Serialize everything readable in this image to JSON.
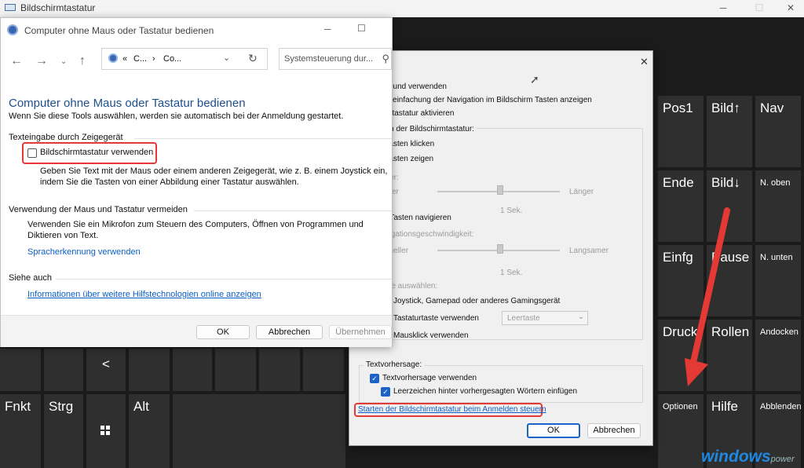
{
  "osk": {
    "title": "Bildschirmtastatur",
    "keys_right": [
      {
        "label": "Pos1"
      },
      {
        "label": "Bild↑"
      },
      {
        "label": "Nav"
      },
      {
        "label": "Ende"
      },
      {
        "label": "Bild↓"
      },
      {
        "label": "N. oben"
      },
      {
        "label": "Einfg"
      },
      {
        "label": "Pause"
      },
      {
        "label": "N. unten"
      },
      {
        "label": "Druck"
      },
      {
        "label": "Rollen"
      },
      {
        "label": "Andocken"
      },
      {
        "label": "Optionen"
      },
      {
        "label": "Hilfe"
      },
      {
        "label": "Abblenden"
      }
    ],
    "bottom_keys": {
      "fn": "Fnkt",
      "ctrl": "Strg",
      "alt": "Alt",
      "left_arrow": "<"
    },
    "watermark": "windowspower"
  },
  "win1": {
    "title": "Computer ohne Maus oder Tastatur bedienen",
    "address_parts": [
      "«",
      "C...",
      "›",
      "Co..."
    ],
    "search_placeholder": "Systemsteuerung dur...",
    "heading": "Computer ohne Maus oder Tastatur bedienen",
    "intro": "Wenn Sie diese Tools auswählen, werden sie automatisch bei der Anmeldung gestartet.",
    "section1": {
      "title": "Texteingabe durch Zeigegerät",
      "checkbox_label": "Bildschirmtastatur verwenden",
      "desc_line1": "Geben Sie Text mit der Maus oder einem anderen Zeigegerät, wie z. B. einem Joystick ein,",
      "desc_line2": "indem Sie die Tasten von einer Abbildung einer Tastatur auswählen."
    },
    "section2": {
      "title": "Verwendung der Maus und Tastatur vermeiden",
      "desc_line1": "Verwenden Sie ein Mikrofon zum Steuern des Computers, Öffnen von Programmen und",
      "desc_line2": "Diktieren von Text.",
      "link": "Spracherkennung verwenden"
    },
    "section3": {
      "title": "Siehe auch",
      "link": "Informationen über weitere Hilfstechnologien online anzeigen"
    },
    "buttons": {
      "ok": "OK",
      "cancel": "Abbrechen",
      "apply": "Übernehmen"
    }
  },
  "dlg": {
    "line1": "ksound verwenden",
    "line2": "Vereinfachung der Navigation im Bildschirm Tasten anzeigen",
    "line3": "nertastatur aktivieren",
    "grp1_title": "den der Bildschirmtastatur:",
    "opt1": "f Tasten klicken",
    "opt2": "f Tasten zeigen",
    "dauer_label": "auer:",
    "kuerzer": "ürzer",
    "laenger": "Länger",
    "sek1": "1 Sek.",
    "navigate": "er Tasten navigieren",
    "nav_speed_label": "avigationsgeschwindigkeit:",
    "schneller": "chneller",
    "langsamer": "Langsamer",
    "sek2": "1 Sek.",
    "taste_label": "aste auswählen:",
    "joystick": "Joystick, Gamepad oder anderes Gamingsgerät",
    "tastaturtaste": "Tastaturtaste verwenden",
    "leertaste": "Leertaste",
    "mausklick": "Mausklick verwenden",
    "textvorhersage_title": "Textvorhersage:",
    "tv1": "Textvorhersage verwenden",
    "tv2": "Leerzeichen hinter vorhergesagten Wörtern einfügen",
    "link_start": "Starten der Bildschirmtastatur beim Anmelden steuern",
    "ok": "OK",
    "cancel": "Abbrechen"
  },
  "colors": {
    "accent_red": "#e53935",
    "link_blue": "#0b5ec7",
    "checkbox_blue": "#1b63c9"
  }
}
